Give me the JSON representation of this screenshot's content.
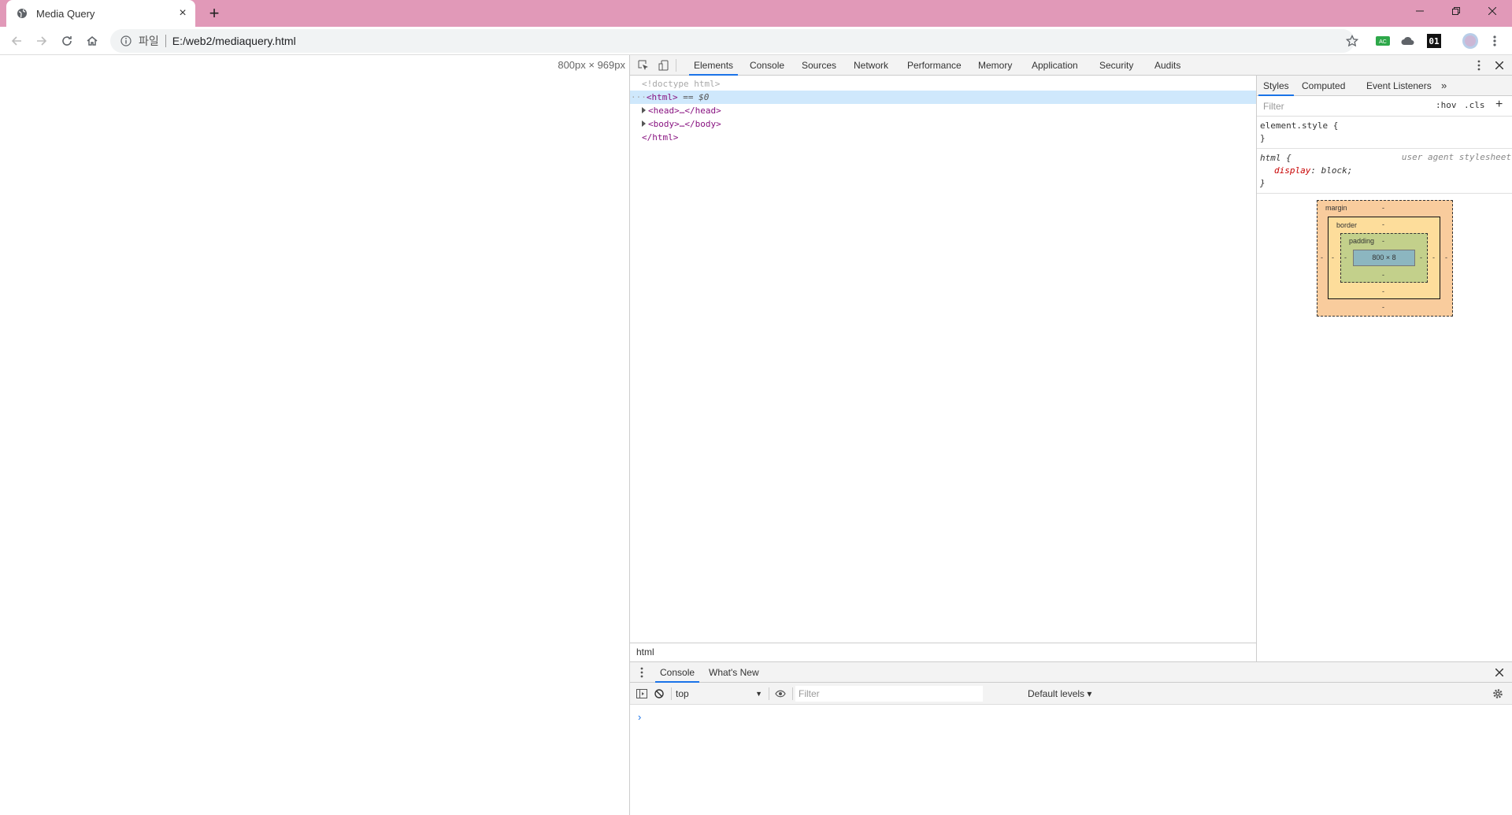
{
  "browser": {
    "tab": {
      "title": "Media Query"
    },
    "omnibox": {
      "scheme_label": "파일",
      "url": "E:/web2/mediaquery.html"
    }
  },
  "page": {
    "dimensions": "800px × 969px"
  },
  "devtools": {
    "tabs": [
      "Elements",
      "Console",
      "Sources",
      "Network",
      "Performance",
      "Memory",
      "Application",
      "Security",
      "Audits"
    ],
    "active_tab": "Elements",
    "dom": {
      "doctype": "<!doctype html>",
      "html_open": "<html>",
      "selected_marker": "== $0",
      "head": "<head>…</head>",
      "body": "<body>…</body>",
      "html_close": "</html>"
    },
    "breadcrumb": "html",
    "styles": {
      "tabs": [
        "Styles",
        "Computed",
        "Event Listeners"
      ],
      "filter_placeholder": "Filter",
      "hov": ":hov",
      "cls": ".cls",
      "element_style_open": "element.style {",
      "element_style_close": "}",
      "rule_selector": "html {",
      "rule_source": "user agent stylesheet",
      "rule_prop": "display",
      "rule_value": "block;",
      "rule_close": "}"
    },
    "box_model": {
      "margin_label": "margin",
      "border_label": "border",
      "padding_label": "padding",
      "content": "800 × 8",
      "dash": "-"
    },
    "drawer": {
      "tabs": [
        "Console",
        "What's New"
      ],
      "context": "top",
      "filter_placeholder": "Filter",
      "levels": "Default levels ▾"
    }
  },
  "colors": {
    "titlebar": "#e199b8",
    "accent": "#1a73e8"
  }
}
